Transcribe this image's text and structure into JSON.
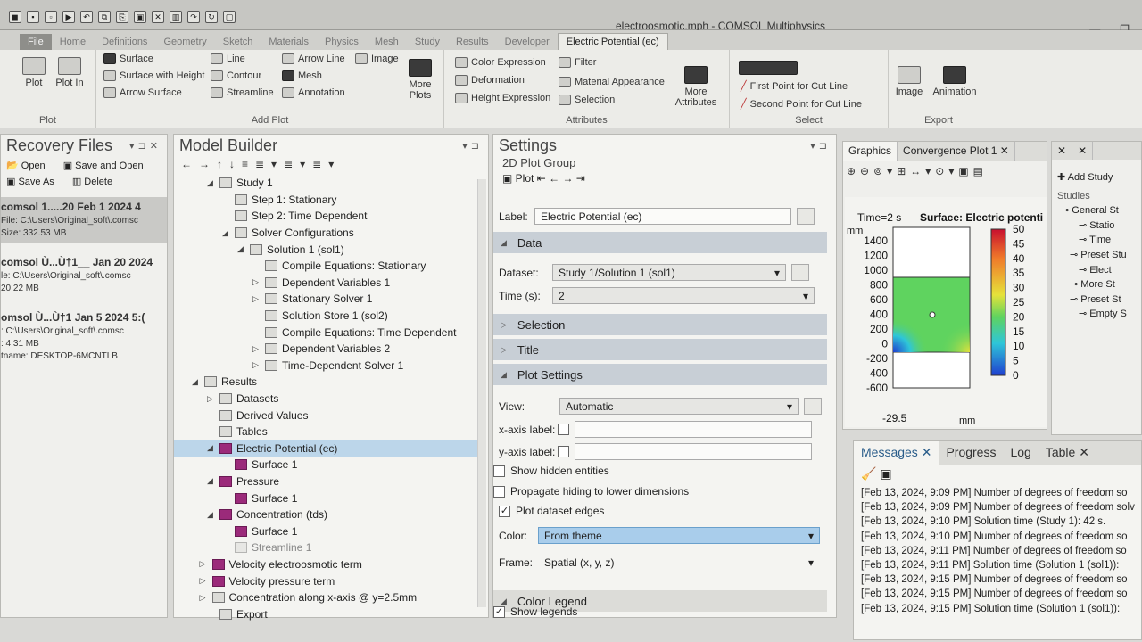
{
  "window": {
    "title": "electroosmotic.mph - COMSOL Multiphysics"
  },
  "ribbon_tabs": [
    "File",
    "Home",
    "Definitions",
    "Geometry",
    "Sketch",
    "Materials",
    "Physics",
    "Mesh",
    "Study",
    "Results",
    "Developer",
    "Electric Potential (ec)"
  ],
  "ribbon": {
    "plot": {
      "plot": "Plot",
      "plot_in": "Plot In",
      "group": "Plot"
    },
    "add_plot": {
      "surface": "Surface",
      "surface_height": "Surface with Height",
      "arrow_surface": "Arrow Surface",
      "line": "Line",
      "contour": "Contour",
      "streamline": "Streamline",
      "arrow_line": "Arrow Line",
      "mesh": "Mesh",
      "annotation": "Annotation",
      "image": "Image",
      "more_plots": "More Plots",
      "group": "Add Plot"
    },
    "attributes": {
      "color_expr": "Color Expression",
      "deformation": "Deformation",
      "height_expr": "Height Expression",
      "filter": "Filter",
      "material_appearance": "Material Appearance",
      "selection": "Selection",
      "more_attributes": "More Attributes",
      "group": "Attributes"
    },
    "select": {
      "first_point": "First Point for Cut Line",
      "second_point": "Second Point for Cut Line",
      "group": "Select"
    },
    "export": {
      "image": "Image",
      "animation": "Animation",
      "group": "Export"
    }
  },
  "recovery": {
    "title": "Recovery Files",
    "open": "Open",
    "save_open": "Save and Open",
    "save_as": "Save As",
    "delete": "Delete",
    "files": [
      {
        "name": "comsol 1.....20 Feb 1 2024 4",
        "file": "File: C:\\Users\\Original_soft\\.comsc",
        "size": "Size: 332.53 MB"
      },
      {
        "name": "comsol Ù...Ù†1__ Jan 20 2024",
        "file": "le: C:\\Users\\Original_soft\\.comsc",
        "size": "20.22 MB"
      },
      {
        "name": "omsol Ù...Ù†1 Jan 5 2024 5:(",
        "file": ": C:\\Users\\Original_soft\\.comsc",
        "size": ": 4.31 MB",
        "host": "tname: DESKTOP-6MCNTLB"
      }
    ]
  },
  "model_builder": {
    "title": "Model Builder",
    "tree": [
      {
        "label": "Study 1",
        "indent": 1,
        "arrow": "down"
      },
      {
        "label": "Step 1: Stationary",
        "indent": 2
      },
      {
        "label": "Step 2: Time Dependent",
        "indent": 2
      },
      {
        "label": "Solver Configurations",
        "indent": 2,
        "arrow": "down"
      },
      {
        "label": "Solution 1 (sol1)",
        "indent": 3,
        "arrow": "down"
      },
      {
        "label": "Compile Equations: Stationary",
        "indent": 4
      },
      {
        "label": "Dependent Variables 1",
        "indent": 4,
        "arrow": "right"
      },
      {
        "label": "Stationary Solver 1",
        "indent": 4,
        "arrow": "right"
      },
      {
        "label": "Solution Store 1 (sol2)",
        "indent": 4
      },
      {
        "label": "Compile Equations: Time Dependent",
        "indent": 4
      },
      {
        "label": "Dependent Variables 2",
        "indent": 4,
        "arrow": "right"
      },
      {
        "label": "Time-Dependent Solver 1",
        "indent": 4,
        "arrow": "right"
      },
      {
        "label": "Results",
        "indent": 0,
        "arrow": "down"
      },
      {
        "label": "Datasets",
        "indent": 1,
        "arrow": "right"
      },
      {
        "label": "Derived Values",
        "indent": 1
      },
      {
        "label": "Tables",
        "indent": 1
      },
      {
        "label": "Electric Potential (ec)",
        "indent": 1,
        "arrow": "down",
        "plot": true,
        "selected": true
      },
      {
        "label": "Surface 1",
        "indent": 2,
        "plot": true
      },
      {
        "label": "Pressure",
        "indent": 1,
        "arrow": "down",
        "plot": true
      },
      {
        "label": "Surface 1",
        "indent": 2,
        "plot": true
      },
      {
        "label": "Concentration (tds)",
        "indent": 1,
        "arrow": "down",
        "plot": true
      },
      {
        "label": "Surface 1",
        "indent": 2,
        "plot": true
      },
      {
        "label": "Streamline 1",
        "indent": 2,
        "faint": true
      },
      {
        "label": "Velocity electroosmotic term",
        "indent": 0.5,
        "arrow": "right",
        "plot": true
      },
      {
        "label": "Velocity pressure term",
        "indent": 0.5,
        "arrow": "right",
        "plot": true
      },
      {
        "label": "Concentration along x-axis @ y=2.5mm",
        "indent": 0.5,
        "arrow": "right"
      },
      {
        "label": "Export",
        "indent": 1
      }
    ]
  },
  "settings": {
    "title": "Settings",
    "subtitle": "2D Plot Group",
    "plot_label": "Plot",
    "label_caption": "Label:",
    "label_value": "Electric Potential (ec)",
    "data_section": "Data",
    "dataset_caption": "Dataset:",
    "dataset_value": "Study 1/Solution 1 (sol1)",
    "time_caption": "Time (s):",
    "time_value": "2",
    "selection_section": "Selection",
    "title_section": "Title",
    "plot_settings_section": "Plot Settings",
    "view_caption": "View:",
    "view_value": "Automatic",
    "xaxis_caption": "x-axis label:",
    "yaxis_caption": "y-axis label:",
    "show_hidden": "Show hidden entities",
    "propagate": "Propagate hiding to lower dimensions",
    "plot_edges": "Plot dataset edges",
    "color_caption": "Color:",
    "color_value": "From theme",
    "frame_caption": "Frame:",
    "frame_value": "Spatial  (x, y, z)",
    "color_legend_section": "Color Legend",
    "show_legends": "Show legends"
  },
  "graphics": {
    "tabs": [
      "Graphics",
      "Convergence Plot 1"
    ],
    "header_time": "Time=2 s",
    "header_surface": "Surface: Electric potenti",
    "unit": "mm",
    "y_ticks": [
      "1400",
      "1200",
      "1000",
      "800",
      "600",
      "400",
      "200",
      "0",
      "-200",
      "-400",
      "-600"
    ],
    "x_tick": "-29.5",
    "x_unit": "mm",
    "legend_ticks": [
      "50",
      "45",
      "40",
      "35",
      "30",
      "25",
      "20",
      "15",
      "10",
      "5",
      "0"
    ]
  },
  "messages": {
    "tabs": [
      "Messages",
      "Progress",
      "Log",
      "Table"
    ],
    "lines": [
      "[Feb 13, 2024, 9:09 PM] Number of degrees of freedom so",
      "[Feb 13, 2024, 9:09 PM] Number of degrees of freedom solv",
      "[Feb 13, 2024, 9:10 PM] Solution time (Study 1): 42 s.",
      "[Feb 13, 2024, 9:10 PM] Number of degrees of freedom so",
      "[Feb 13, 2024, 9:11 PM] Number of degrees of freedom so",
      "[Feb 13, 2024, 9:11 PM] Solution time (Solution 1 (sol1)):",
      "[Feb 13, 2024, 9:15 PM] Number of degrees of freedom so",
      "[Feb 13, 2024, 9:15 PM] Number of degrees of freedom so",
      "[Feb 13, 2024, 9:15 PM] Solution time (Solution 1 (sol1)):"
    ]
  },
  "studies": {
    "add_study": "Add Study",
    "heading": "Studies",
    "items": [
      "General St",
      "Statio",
      "Time",
      "Preset Stu",
      "Elect",
      "More St",
      "Preset St",
      "Empty S"
    ]
  }
}
